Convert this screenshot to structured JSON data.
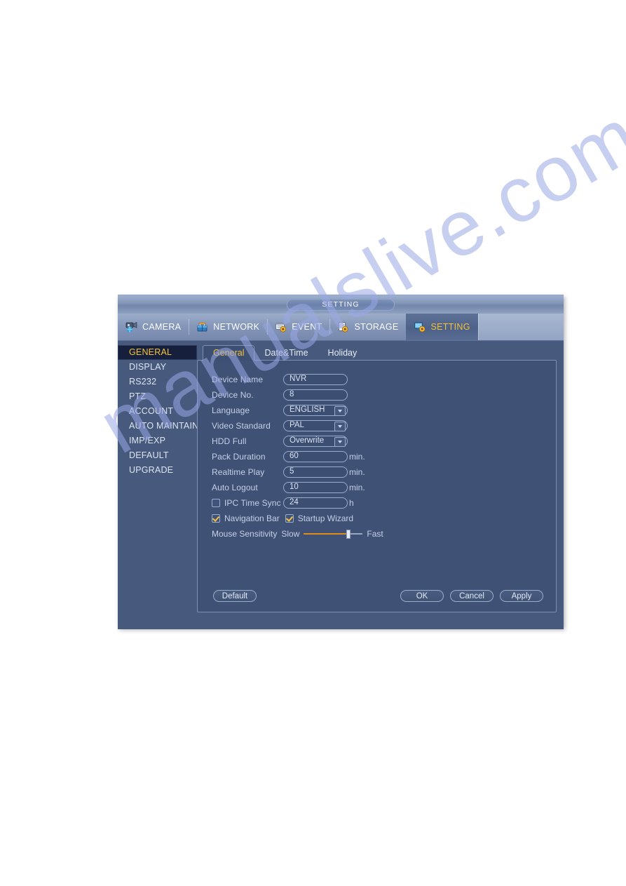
{
  "watermark": {
    "text": "manualslive.com"
  },
  "window": {
    "title": "SETTING",
    "nav": [
      {
        "label": "CAMERA",
        "icon": "camera-icon",
        "active": false
      },
      {
        "label": "NETWORK",
        "icon": "network-icon",
        "active": false
      },
      {
        "label": "EVENT",
        "icon": "event-icon",
        "active": false
      },
      {
        "label": "STORAGE",
        "icon": "storage-icon",
        "active": false
      },
      {
        "label": "SETTING",
        "icon": "setting-icon",
        "active": true
      }
    ],
    "sidebar": [
      {
        "label": "GENERAL",
        "active": true
      },
      {
        "label": "DISPLAY",
        "active": false
      },
      {
        "label": "RS232",
        "active": false
      },
      {
        "label": "PTZ",
        "active": false
      },
      {
        "label": "ACCOUNT",
        "active": false
      },
      {
        "label": "AUTO MAINTAIN",
        "active": false
      },
      {
        "label": "IMP/EXP",
        "active": false
      },
      {
        "label": "DEFAULT",
        "active": false
      },
      {
        "label": "UPGRADE",
        "active": false
      }
    ],
    "tabs": [
      {
        "label": "General",
        "active": true
      },
      {
        "label": "Date&Time",
        "active": false
      },
      {
        "label": "Holiday",
        "active": false
      }
    ],
    "form": {
      "device_name": {
        "label": "Device Name",
        "value": "NVR"
      },
      "device_no": {
        "label": "Device No.",
        "value": "8"
      },
      "language": {
        "label": "Language",
        "value": "ENGLISH",
        "type": "select"
      },
      "video_standard": {
        "label": "Video Standard",
        "value": "PAL",
        "type": "select"
      },
      "hdd_full": {
        "label": "HDD Full",
        "value": "Overwrite",
        "type": "select"
      },
      "pack_duration": {
        "label": "Pack Duration",
        "value": "60",
        "unit": "min."
      },
      "realtime_play": {
        "label": "Realtime Play",
        "value": "5",
        "unit": "min."
      },
      "auto_logout": {
        "label": "Auto Logout",
        "value": "10",
        "unit": "min."
      },
      "ipc_time_sync": {
        "label": "IPC Time Sync",
        "value": "24",
        "unit": "h",
        "checked": false
      },
      "navigation_bar": {
        "label": "Navigation Bar",
        "checked": true
      },
      "startup_wizard": {
        "label": "Startup Wizard",
        "checked": true
      },
      "mouse_sensitivity": {
        "label": "Mouse Sensitivity",
        "min_label": "Slow",
        "max_label": "Fast",
        "percent": 78
      }
    },
    "buttons": {
      "default": "Default",
      "ok": "OK",
      "cancel": "Cancel",
      "apply": "Apply"
    }
  },
  "colors": {
    "accent_yellow": "#f5c23a",
    "slider_orange": "#e08c1c",
    "panel_blue": "#3f5175",
    "window_blue": "#475a7d",
    "watermark_blue": "#9aa8e6"
  }
}
